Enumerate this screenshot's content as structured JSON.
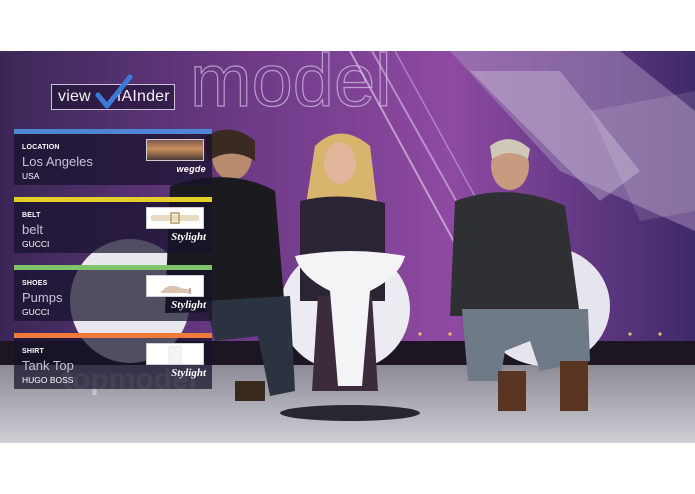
{
  "app": {
    "logo_left": "view",
    "logo_right": "fAInder"
  },
  "colors": {
    "location": "#4f86d4",
    "belt": "#e4cf2a",
    "shoes": "#7fc46a",
    "shirt": "#f07a3c"
  },
  "panels": [
    {
      "category": "LOCATION",
      "name": "Los Angeles",
      "brand": "USA",
      "shop": "wegde"
    },
    {
      "category": "BELT",
      "name": "belt",
      "brand": "GUCCI",
      "shop": "Stylight"
    },
    {
      "category": "SHOES",
      "name": "Pumps",
      "brand": "GUCCI",
      "shop": "Stylight"
    },
    {
      "category": "SHIRT",
      "name": "Tank Top",
      "brand": "HUGO BOSS",
      "shop": "Stylight"
    }
  ],
  "icons": {
    "logo": "checkmark-icon"
  }
}
